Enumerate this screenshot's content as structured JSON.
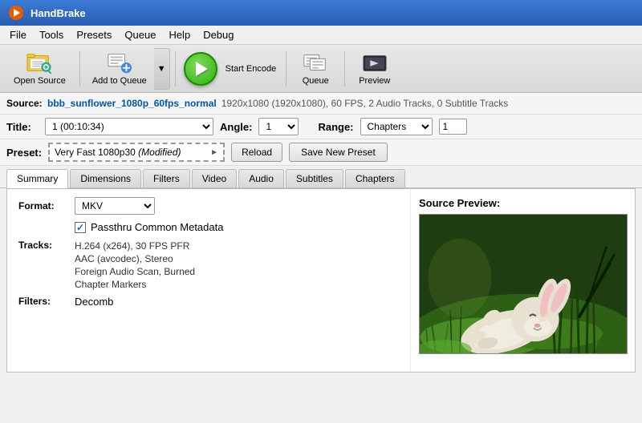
{
  "app": {
    "title": "HandBrake",
    "icon_color": "#e85c00"
  },
  "menu": {
    "items": [
      "File",
      "Tools",
      "Presets",
      "Queue",
      "Help",
      "Debug"
    ]
  },
  "toolbar": {
    "open_source": "Open Source",
    "add_to_queue": "Add to Queue",
    "start_encode": "Start Encode",
    "queue": "Queue",
    "preview": "Preview"
  },
  "source": {
    "label": "Source:",
    "filename": "bbb_sunflower_1080p_60fps_normal",
    "meta": "1920x1080 (1920x1080), 60 FPS, 2 Audio Tracks, 0 Subtitle Tracks"
  },
  "title_row": {
    "title_label": "Title:",
    "title_value": "1 (00:10:34)",
    "angle_label": "Angle:",
    "angle_value": "1",
    "range_label": "Range:",
    "range_value": "Chapters",
    "range_num": "1"
  },
  "preset_row": {
    "label": "Preset:",
    "preset_name": "Very Fast 1080p30",
    "preset_modified": "(Modified)",
    "reload_btn": "Reload",
    "save_btn": "Save New Preset"
  },
  "tabs": {
    "items": [
      "Summary",
      "Dimensions",
      "Filters",
      "Video",
      "Audio",
      "Subtitles",
      "Chapters"
    ],
    "active": 0
  },
  "summary": {
    "format_label": "Format:",
    "format_value": "MKV",
    "metadata_label": "Passthru Common Metadata",
    "tracks_label": "Tracks:",
    "tracks": [
      "H.264 (x264), 30 FPS PFR",
      "AAC (avcodec), Stereo",
      "Foreign Audio Scan, Burned",
      "Chapter Markers"
    ],
    "filters_label": "Filters:",
    "filters_value": "Decomb",
    "preview_label": "Source Preview:"
  }
}
